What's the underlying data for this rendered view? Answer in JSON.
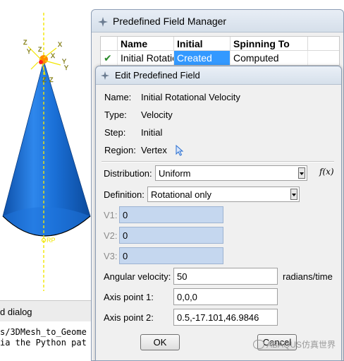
{
  "viewport": {
    "axis_labels": [
      "Z",
      "X",
      "Y",
      "Z",
      "Y",
      "Z",
      "Y",
      "X",
      "Z"
    ],
    "rp_label": "RP"
  },
  "message_area": {
    "text": "d dialog"
  },
  "console": {
    "lines": [
      "s/3DMesh_to_Geome",
      "ia the Python pat"
    ]
  },
  "manager": {
    "title": "Predefined Field Manager",
    "columns": [
      "Name",
      "Initial",
      "Spinning To"
    ],
    "rows": [
      {
        "check": "✔",
        "name": "Initial Rotatic",
        "initial": "Created",
        "spinning": "Computed"
      }
    ]
  },
  "edit_dialog": {
    "title": "Edit Predefined Field",
    "info": [
      {
        "label": "Name:",
        "value": "Initial Rotational Velocity"
      },
      {
        "label": "Type:",
        "value": "Velocity"
      },
      {
        "label": "Step:",
        "value": "Initial"
      },
      {
        "label": "Region:",
        "value": "Vertex"
      }
    ],
    "distribution_label": "Distribution:",
    "distribution_value": "Uniform",
    "fx_label": "f(x)",
    "definition_label": "Definition:",
    "definition_value": "Rotational only",
    "v1_label": "V1:",
    "v1_value": "0",
    "v2_label": "V2:",
    "v2_value": "0",
    "v3_label": "V3:",
    "v3_value": "0",
    "angular_label": "Angular velocity:",
    "angular_value": "50",
    "angular_unit": "radians/time",
    "axis1_label": "Axis point 1:",
    "axis1_value": "0,0,0",
    "axis2_label": "Axis point 2:",
    "axis2_value": "0.5,-17.101,46.9846",
    "ok_label": "OK",
    "cancel_label": "Cancel"
  },
  "watermark": "ABAQUS仿真世界",
  "colors": {
    "cone": "#1a6fd6",
    "selection": "#3399ff",
    "axis_line": "#f2e600",
    "vfield": "#c5d7ef"
  }
}
